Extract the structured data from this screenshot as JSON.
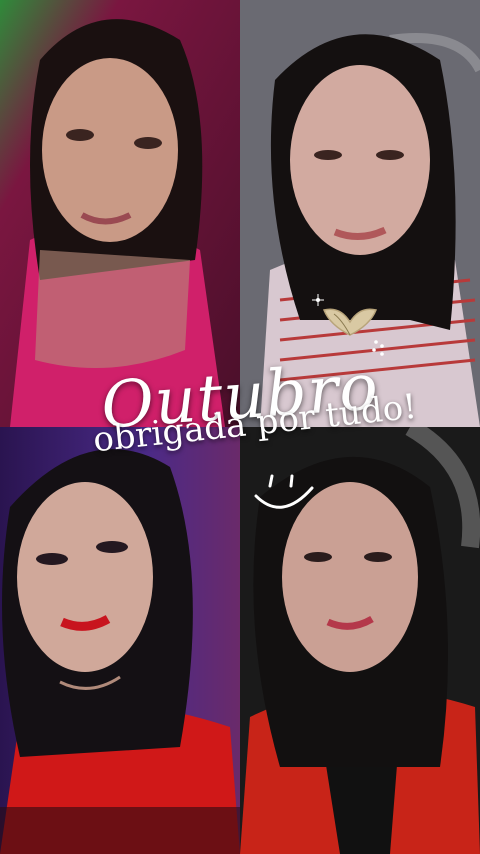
{
  "overlay": {
    "title": "Outubro",
    "subtitle": "obrigada por tudo!"
  },
  "photos": [
    {
      "name": "top-left",
      "background": "#7a1640",
      "shirt": "#d0206a"
    },
    {
      "name": "top-right",
      "background": "#6a6a72",
      "shirt": "#d8c8d0"
    },
    {
      "name": "bottom-left",
      "background": "#3b1f66",
      "shirt": "#d01818"
    },
    {
      "name": "bottom-right",
      "background": "#1a1a1a",
      "shirt": "#c82418"
    }
  ],
  "decorations": {
    "heart_color": "#d9c9a3"
  }
}
